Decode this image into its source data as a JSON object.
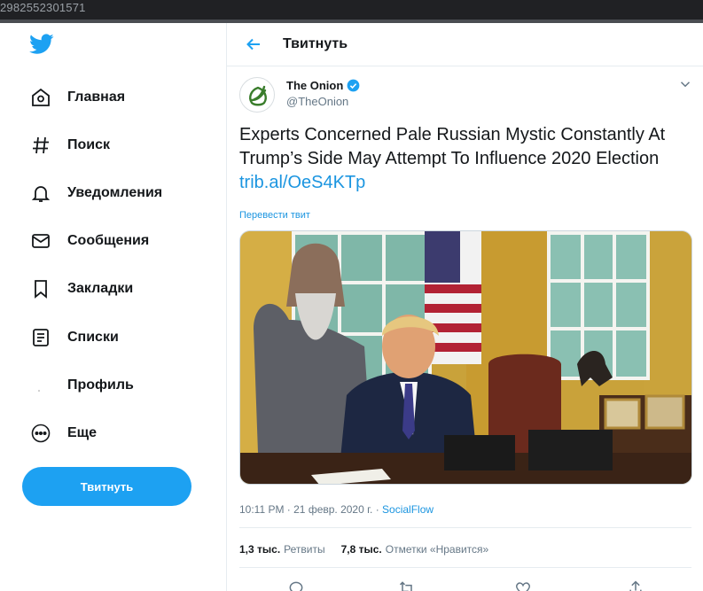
{
  "browser": {
    "url_fragment": "2982552301571"
  },
  "nav": {
    "items": [
      {
        "label": "Главная",
        "icon": "home-icon"
      },
      {
        "label": "Поиск",
        "icon": "hashtag-icon"
      },
      {
        "label": "Уведомления",
        "icon": "bell-icon"
      },
      {
        "label": "Сообщения",
        "icon": "mail-icon"
      },
      {
        "label": "Закладки",
        "icon": "bookmark-icon"
      },
      {
        "label": "Списки",
        "icon": "list-icon"
      },
      {
        "label": "Профиль",
        "icon": "profile-icon"
      },
      {
        "label": "Еще",
        "icon": "more-icon"
      }
    ],
    "tweet_button": "Твитнуть"
  },
  "header": {
    "title": "Твитнуть"
  },
  "tweet": {
    "author_name": "The Onion",
    "author_handle": "@TheOnion",
    "text": "Experts Concerned Pale Russian Mystic Constantly At Trump’s Side May Attempt To Influence 2020 Election",
    "link": "trib.al/OeS4KTp",
    "translate": "Перевести твит",
    "timestamp": "10:11 PM · 21 февр. 2020 г.",
    "separator": " · ",
    "source": "SocialFlow",
    "retweets_count": "1,3 тыс.",
    "retweets_label": "Ретвиты",
    "likes_count": "7,8 тыс.",
    "likes_label": "Отметки «Нравится»"
  },
  "colors": {
    "accent": "#1da1f2",
    "link": "#1b95e0",
    "text": "#14171a",
    "muted": "#657786",
    "onion_green": "#3a7d2c"
  }
}
